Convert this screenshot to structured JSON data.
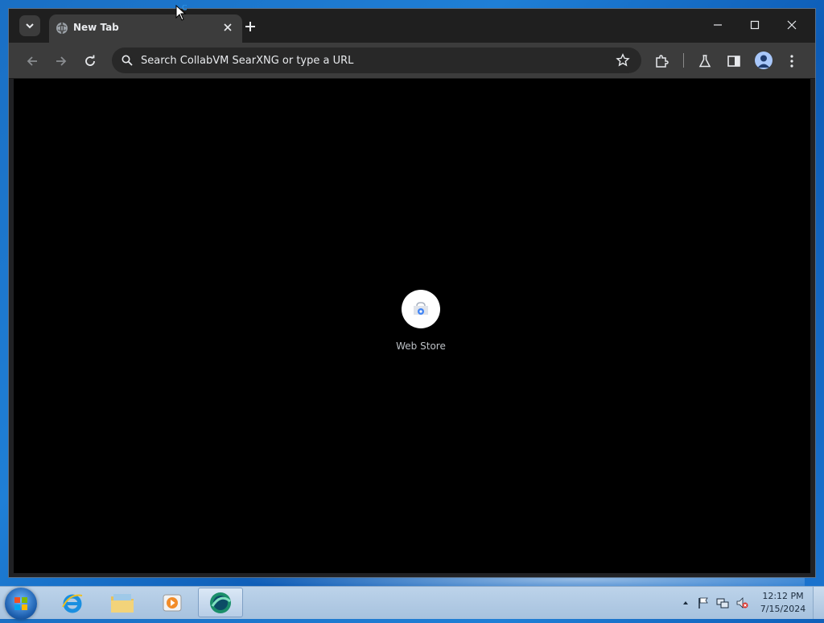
{
  "browser": {
    "tab": {
      "title": "New Tab"
    },
    "omnibox": {
      "placeholder": "Search CollabVM SearXNG or type a URL"
    }
  },
  "new_tab_page": {
    "shortcuts": [
      {
        "label": "Web Store",
        "icon": "chrome-web-store-icon"
      }
    ]
  },
  "taskbar": {
    "apps": [
      {
        "name": "internet-explorer",
        "icon": "ie-icon"
      },
      {
        "name": "windows-explorer",
        "icon": "folder-icon"
      },
      {
        "name": "windows-media-player",
        "icon": "media-player-icon"
      },
      {
        "name": "browser",
        "icon": "browser-icon",
        "active": true
      }
    ],
    "clock": {
      "time": "12:12 PM",
      "date": "7/15/2024"
    }
  },
  "colors": {
    "tabstrip": "#1f1f1f",
    "toolbar": "#3c3c3c",
    "omnibox": "#282828",
    "content": "#000000",
    "taskbar": "#a7c2de"
  }
}
